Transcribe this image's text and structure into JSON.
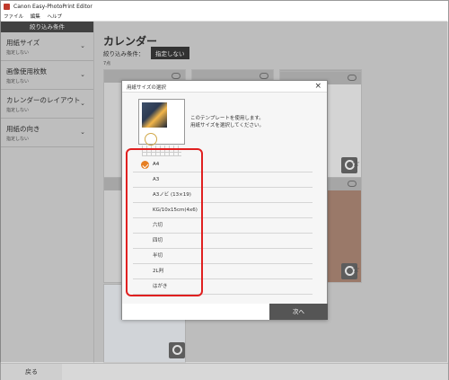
{
  "window": {
    "title": "Canon Easy-PhotoPrint Editor"
  },
  "menu": {
    "items": [
      "ファイル",
      "編集",
      "ヘルプ"
    ]
  },
  "sidebar": {
    "header": "絞り込み条件",
    "filters": [
      {
        "label": "用紙サイズ",
        "value": "指定しない"
      },
      {
        "label": "画像使用枚数",
        "value": "指定しない"
      },
      {
        "label": "カレンダーのレイアウト",
        "value": "指定しない"
      },
      {
        "label": "用紙の向き",
        "value": "指定しない"
      }
    ],
    "back_label": "戻る"
  },
  "main": {
    "title": "カレンダー",
    "condition_label": "絞り込み条件：",
    "condition_value": "指定しない",
    "count": "7点"
  },
  "dialog": {
    "title": "用紙サイズの選択",
    "instruction_line1": "このテンプレートを使用します。",
    "instruction_line2": "用紙サイズを選択してください。",
    "sizes": [
      "A4",
      "A3",
      "A3ノビ (13×19)",
      "KG/10x15cm(4x6)",
      "六切",
      "四切",
      "半切",
      "2L判",
      "はがき"
    ],
    "selected_size": "A4",
    "next_label": "次へ",
    "close_label": "×"
  },
  "colors": {
    "accent": "#e67e22",
    "highlight": "#e02020",
    "dark_button": "#555555"
  }
}
